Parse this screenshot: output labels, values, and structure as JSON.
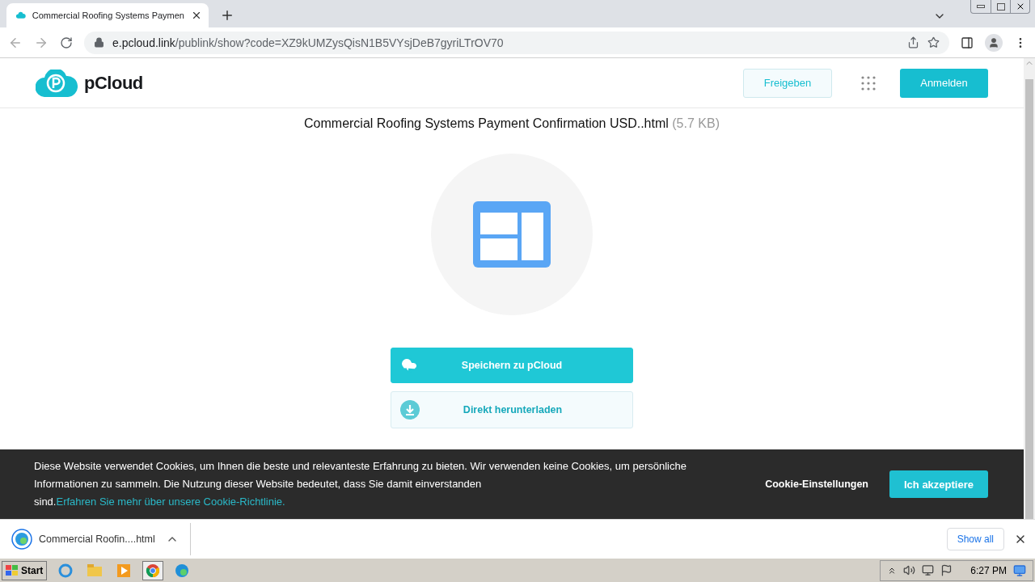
{
  "browser": {
    "tab_title": "Commercial Roofing Systems Paymen",
    "url_host": "e.pcloud.link",
    "url_path": "/publink/show?code=XZ9kUMZysQisN1B5VYsjDeB7gyriLTrOV70"
  },
  "header": {
    "logo": "pCloud",
    "share_button": "Freigeben",
    "login_button": "Anmelden"
  },
  "file": {
    "name": "Commercial Roofing Systems Payment Confirmation USD..html",
    "size": "(5.7 KB)"
  },
  "actions": [
    {
      "kind": "primary",
      "label": "Speichern zu pCloud"
    },
    {
      "kind": "secondary",
      "label": "Direkt herunterladen"
    }
  ],
  "cookie_banner": {
    "text": "Diese Website verwendet Cookies, um Ihnen die beste und relevanteste Erfahrung zu bieten. Wir verwenden keine Cookies, um persönliche Informationen zu sammeln. Die Nutzung dieser Website bedeutet, dass Sie damit einverstanden sind.",
    "link": "Erfahren Sie mehr über unsere Cookie-Richtlinie.",
    "settings": "Cookie-Einstellungen",
    "accept": "Ich akzeptiere"
  },
  "download_shelf": {
    "item": "Commercial Roofin....html",
    "show_all": "Show all"
  },
  "taskbar": {
    "start": "Start",
    "clock": "6:27 PM"
  }
}
